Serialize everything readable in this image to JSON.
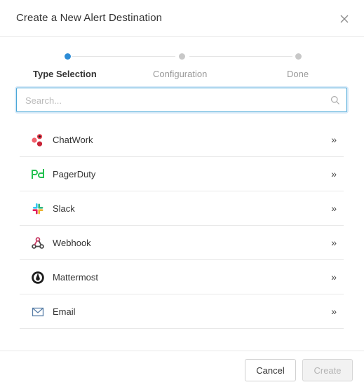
{
  "dialog": {
    "title": "Create a New Alert Destination"
  },
  "steps": [
    {
      "label": "Type Selection",
      "state": "active"
    },
    {
      "label": "Configuration",
      "state": "pending"
    },
    {
      "label": "Done",
      "state": "pending"
    }
  ],
  "search": {
    "placeholder": "Search...",
    "value": ""
  },
  "destinations": [
    {
      "label": "ChatWork",
      "icon": "chatwork-icon"
    },
    {
      "label": "PagerDuty",
      "icon": "pagerduty-icon"
    },
    {
      "label": "Slack",
      "icon": "slack-icon"
    },
    {
      "label": "Webhook",
      "icon": "webhook-icon"
    },
    {
      "label": "Mattermost",
      "icon": "mattermost-icon"
    },
    {
      "label": "Email",
      "icon": "email-icon"
    }
  ],
  "chevron": "»",
  "footer": {
    "cancel_label": "Cancel",
    "create_label": "Create"
  },
  "colors": {
    "accent": "#2d8cd6",
    "chatwork": "#e8394a",
    "pagerduty": "#25c151"
  }
}
